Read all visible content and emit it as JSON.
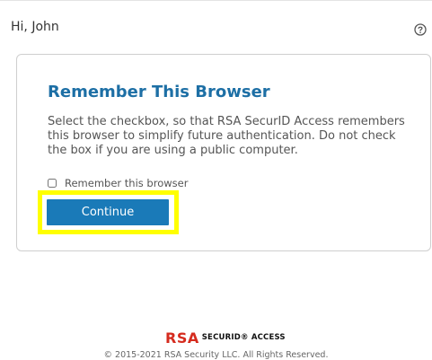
{
  "header": {
    "greeting": "Hi, John",
    "help_icon": "question-circle-icon"
  },
  "card": {
    "title": "Remember This Browser",
    "body": "Select the checkbox, so that RSA SecurID Access remembers this browser to simplify future authentication. Do not check the box if you are using a public computer.",
    "remember_label": "Remember this browser",
    "remember_checked": false,
    "continue_label": "Continue",
    "highlight_color": "#ffff00"
  },
  "footer": {
    "logo_rsa": "RSA",
    "logo_text": "SECURID® ACCESS",
    "copyright": "© 2015-2021 RSA Security LLC. All Rights Reserved."
  },
  "colors": {
    "title": "#1d6fa5",
    "button": "#1a7ab8",
    "logo_red": "#d52b1e"
  }
}
